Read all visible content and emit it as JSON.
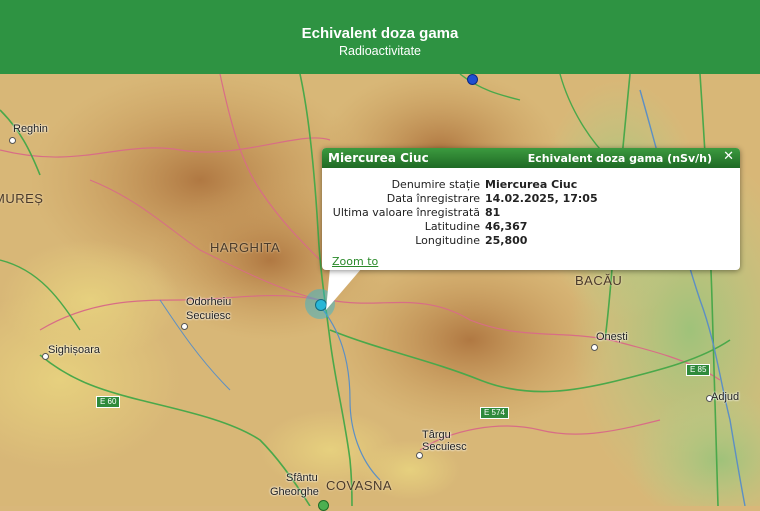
{
  "header": {
    "title": "Echivalent doza gama",
    "subtitle": "Radioactivitate"
  },
  "popup": {
    "station_name": "Miercurea Ciuc",
    "measure": "Echivalent doza gama (nSv/h)",
    "close": "✕",
    "rows": [
      {
        "label": "Denumire stație",
        "value": "Miercurea Ciuc"
      },
      {
        "label": "Data înregistrare",
        "value": "14.02.2025, 17:05"
      },
      {
        "label": "Ultima valoare înregistrată",
        "value": "81"
      },
      {
        "label": "Latitudine",
        "value": "46,367"
      },
      {
        "label": "Longitudine",
        "value": "25,800"
      }
    ],
    "zoom_label": "Zoom to"
  },
  "map": {
    "places": {
      "reghin": "Reghin",
      "mures": "MUREȘ",
      "harghita": "HARGHITA",
      "odorheiu": "Odorheiu",
      "secuiesc": "Secuiesc",
      "sighisoara": "Sighișoara",
      "bacau": "BACĂU",
      "onesti": "Onești",
      "adjud": "Adjud",
      "targu": "Târgu",
      "targu2": "Secuiesc",
      "sfantu": "Sfântu",
      "gheorghe": "Gheorghe",
      "covasna": "COVASNA"
    },
    "roads": {
      "e60": "E 60",
      "e574": "E 574",
      "e85": "E 85"
    },
    "colors": {
      "header": "#2e9342",
      "station_selected": "#27b6d6",
      "station_blue": "#1f4fd1",
      "station_green": "#4caf50"
    }
  }
}
